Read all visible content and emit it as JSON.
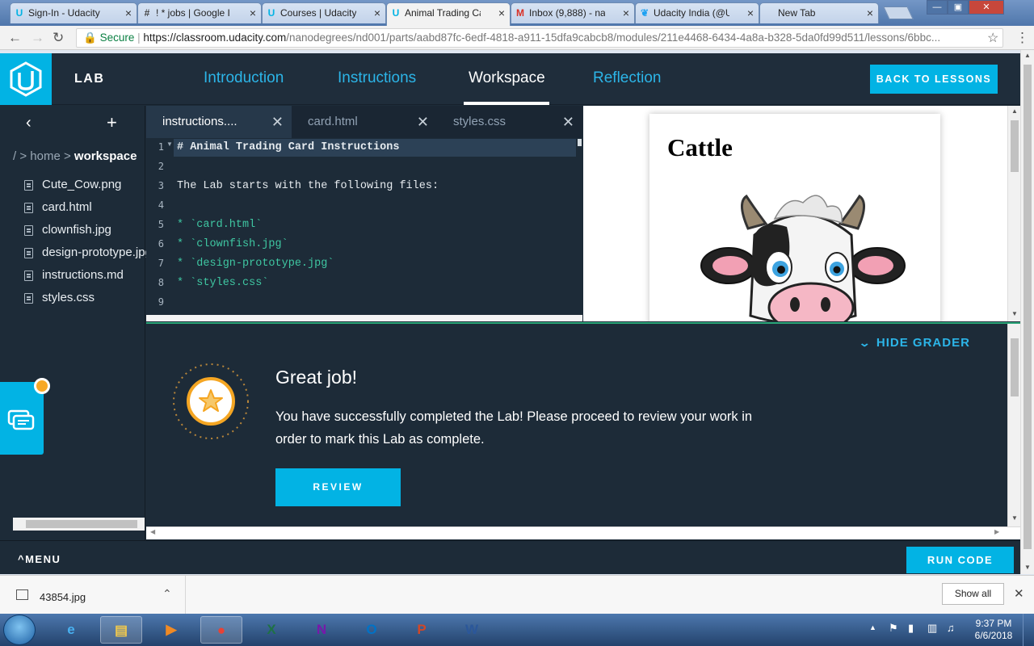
{
  "browser": {
    "tabs": [
      {
        "title": "Sign-In - Udacity",
        "icon": "udacity-icon"
      },
      {
        "title": "! * jobs | Google I",
        "icon": "hash-icon"
      },
      {
        "title": "Courses | Udacity",
        "icon": "udacity-icon"
      },
      {
        "title": "Animal Trading Ca",
        "icon": "udacity-icon"
      },
      {
        "title": "Inbox (9,888) - na",
        "icon": "gmail-icon"
      },
      {
        "title": "Udacity India (@U",
        "icon": "twitter-icon"
      },
      {
        "title": "New Tab",
        "icon": ""
      }
    ],
    "secure_label": "Secure",
    "url_host": "https://classroom.udacity.com",
    "url_path": "/nanodegrees/nd001/parts/aabd87fc-6edf-4818-a911-15dfa9cabcb8/modules/211e4468-6434-4a8a-b328-5da0fd99d511/lessons/6bbc..."
  },
  "header": {
    "section": "LAB",
    "tabs": [
      "Introduction",
      "Instructions",
      "Workspace",
      "Reflection"
    ],
    "active_tab": "Workspace",
    "back_button": "BACK TO LESSONS"
  },
  "sidebar": {
    "breadcrumb_root": "/ > ",
    "breadcrumb_home": "home",
    "breadcrumb_sep": " > ",
    "breadcrumb_current": "workspace",
    "files": [
      "Cute_Cow.png",
      "card.html",
      "clownfish.jpg",
      "design-prototype.jpg",
      "instructions.md",
      "styles.css"
    ]
  },
  "editor": {
    "tabs": [
      "instructions....",
      "card.html",
      "styles.css"
    ],
    "active_tab": "instructions....",
    "lines": [
      {
        "n": "1",
        "text": "# Animal Trading Card Instructions",
        "style": "heading"
      },
      {
        "n": "2",
        "text": "",
        "style": "plain"
      },
      {
        "n": "3",
        "text": "The Lab starts with the following files:",
        "style": "plain"
      },
      {
        "n": "4",
        "text": "",
        "style": "plain"
      },
      {
        "n": "5",
        "text": "* `card.html`",
        "style": "list"
      },
      {
        "n": "6",
        "text": "* `clownfish.jpg`",
        "style": "list"
      },
      {
        "n": "7",
        "text": "* `design-prototype.jpg`",
        "style": "list"
      },
      {
        "n": "8",
        "text": "* `styles.css`",
        "style": "list"
      },
      {
        "n": "9",
        "text": "",
        "style": "plain"
      }
    ]
  },
  "preview": {
    "card_title": "Cattle"
  },
  "grader": {
    "hide_label": "HIDE GRADER",
    "title": "Great job!",
    "message": "You have successfully completed the Lab! Please proceed to review your work in order to mark this Lab as complete.",
    "review_button": "REVIEW"
  },
  "bottom": {
    "menu": "MENU",
    "run_button": "RUN CODE"
  },
  "download": {
    "file": "43854.jpg",
    "show_all": "Show all"
  },
  "taskbar": {
    "apps": [
      "internet-explorer",
      "file-explorer",
      "media-player",
      "chrome",
      "excel",
      "onenote",
      "outlook",
      "powerpoint",
      "word"
    ],
    "time": "9:37 PM",
    "date": "6/6/2018"
  },
  "colors": {
    "udacity_blue": "#02b3e4",
    "panel": "#1d2b38",
    "star_orange": "#f5a623",
    "success_green": "#2aa578"
  }
}
